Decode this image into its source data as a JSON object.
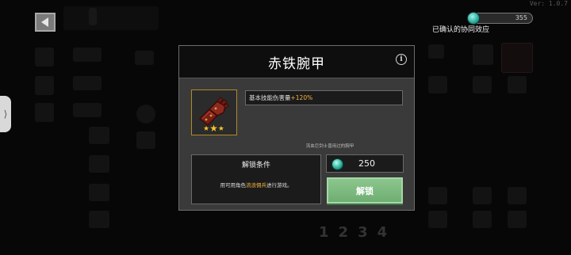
{
  "app": {
    "version": "Ver: 1.0.7"
  },
  "hud": {
    "gems": "355",
    "synergy_label": "已确认的协同效应"
  },
  "modal": {
    "title": "赤铁腕甲",
    "item": {
      "icon": "gauntlet-icon",
      "stars": 3
    },
    "effect": {
      "prefix": "基本技能伤害量",
      "value": "+120%"
    },
    "flavor_text": "流血巨剑士曾用过的腕甲",
    "unlock_condition": {
      "title": "解锁条件",
      "desc_prefix": "用可用角色",
      "character": "流浪佣兵",
      "desc_suffix": "进行游戏。"
    },
    "price": "250",
    "unlock_button_label": "解锁"
  },
  "colors": {
    "highlight": "#f3b63f",
    "button_green": "#7cba80",
    "gem": "#2aa89a"
  }
}
